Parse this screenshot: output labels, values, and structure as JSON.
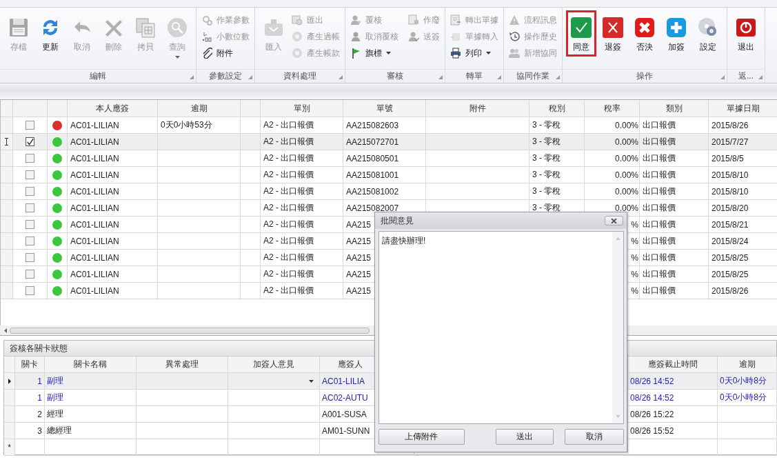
{
  "ribbon": {
    "groups": [
      {
        "label": "編輯",
        "items": [
          {
            "kind": "large",
            "label": "存檔",
            "disabled": true,
            "dropdown": false
          },
          {
            "kind": "large",
            "label": "更新",
            "disabled": false,
            "dropdown": false
          },
          {
            "kind": "large",
            "label": "取消",
            "disabled": true,
            "dropdown": false
          },
          {
            "kind": "large",
            "label": "刪除",
            "disabled": true,
            "dropdown": false
          },
          {
            "kind": "large",
            "label": "拷貝",
            "disabled": true,
            "dropdown": false
          },
          {
            "kind": "large",
            "label": "查詢",
            "disabled": true,
            "dropdown": true
          }
        ]
      },
      {
        "label": "參數設定",
        "items": [
          {
            "kind": "small",
            "label": "作業參數",
            "disabled": true
          },
          {
            "kind": "small",
            "label": "小數位數",
            "disabled": true
          },
          {
            "kind": "small",
            "label": "附件",
            "disabled": false
          }
        ]
      },
      {
        "label": "資料處理",
        "items": [
          {
            "kind": "large",
            "label": "匯入",
            "disabled": true
          },
          {
            "kind": "small",
            "label": "匯出",
            "disabled": true
          },
          {
            "kind": "small",
            "label": "產生過帳",
            "disabled": true
          },
          {
            "kind": "small",
            "label": "產生帳款",
            "disabled": true
          }
        ]
      },
      {
        "label": "審核",
        "items": [
          {
            "kind": "small",
            "label": "覆核",
            "disabled": true,
            "dropdown": false
          },
          {
            "kind": "small",
            "label": "取消覆核",
            "disabled": true,
            "dropdown": false
          },
          {
            "kind": "small",
            "label": "旗標",
            "disabled": false,
            "dropdown": true
          },
          {
            "kind": "small",
            "label": "作廢",
            "disabled": true,
            "dropdown": false
          },
          {
            "kind": "small",
            "label": "送簽",
            "disabled": true,
            "dropdown": false
          }
        ]
      },
      {
        "label": "轉單",
        "items": [
          {
            "kind": "small",
            "label": "轉出單據",
            "disabled": true,
            "dropdown": false
          },
          {
            "kind": "small",
            "label": "單據轉入",
            "disabled": true,
            "dropdown": false
          },
          {
            "kind": "small",
            "label": "列印",
            "disabled": false,
            "dropdown": true
          }
        ]
      },
      {
        "label": "協同作業",
        "items": [
          {
            "kind": "small",
            "label": "流程訊息",
            "disabled": true
          },
          {
            "kind": "small",
            "label": "操作歷史",
            "disabled": true
          },
          {
            "kind": "small",
            "label": "新增協同",
            "disabled": true
          }
        ]
      },
      {
        "label": "操作",
        "items": [
          {
            "kind": "large",
            "label": "同意",
            "disabled": false,
            "highlighted": true
          },
          {
            "kind": "large",
            "label": "退簽",
            "disabled": false,
            "highlighted": false
          },
          {
            "kind": "large",
            "label": "否決",
            "disabled": false,
            "highlighted": false
          },
          {
            "kind": "large",
            "label": "加簽",
            "disabled": false,
            "highlighted": false
          },
          {
            "kind": "large",
            "label": "設定",
            "disabled": false,
            "highlighted": false
          }
        ]
      },
      {
        "label": "返...",
        "items": [
          {
            "kind": "large",
            "label": "退出",
            "disabled": false
          }
        ]
      }
    ]
  },
  "documents": {
    "columns": [
      "本人應簽",
      "逾期",
      "單別",
      "單號",
      "附件",
      "稅別",
      "稅率",
      "類別",
      "單據日期"
    ],
    "rows": [
      {
        "selected": false,
        "checked": false,
        "color": "#d8312e",
        "signer": "AC01-LILIAN",
        "overdue": "0天0小時53分",
        "doc_type": "A2 - 出口報價",
        "doc_no": "AA215082603",
        "tax_type": "3 - 零稅",
        "tax_rate": "0.00%",
        "category": "出口報價",
        "date": "2015/8/26"
      },
      {
        "selected": true,
        "checked": true,
        "color": "#3cc63c",
        "signer": "AC01-LILIAN",
        "doc_type": "A2 - 出口報價",
        "doc_no": "AA215072701",
        "tax_type": "3 - 零稅",
        "tax_rate": "0.00%",
        "category": "出口報價",
        "date": "2015/7/27"
      },
      {
        "selected": false,
        "checked": false,
        "color": "#3cc63c",
        "signer": "AC01-LILIAN",
        "doc_type": "A2 - 出口報價",
        "doc_no": "AA215080501",
        "tax_type": "3 - 零稅",
        "tax_rate": "0.00%",
        "category": "出口報價",
        "date": "2015/8/5"
      },
      {
        "selected": false,
        "checked": false,
        "color": "#3cc63c",
        "signer": "AC01-LILIAN",
        "doc_type": "A2 - 出口報價",
        "doc_no": "AA215081001",
        "tax_type": "3 - 零稅",
        "tax_rate": "0.00%",
        "category": "出口報價",
        "date": "2015/8/10"
      },
      {
        "selected": false,
        "checked": false,
        "color": "#3cc63c",
        "signer": "AC01-LILIAN",
        "doc_type": "A2 - 出口報價",
        "doc_no": "AA215081002",
        "tax_type": "3 - 零稅",
        "tax_rate": "0.00%",
        "category": "出口報價",
        "date": "2015/8/10"
      },
      {
        "selected": false,
        "checked": false,
        "color": "#3cc63c",
        "signer": "AC01-LILIAN",
        "doc_type": "A2 - 出口報價",
        "doc_no": "AA215082007",
        "tax_type": "3 - 零稅",
        "tax_rate": "0.00%",
        "category": "出口報價",
        "date": "2015/8/20"
      },
      {
        "selected": false,
        "checked": false,
        "color": "#3cc63c",
        "signer": "AC01-LILIAN",
        "doc_type": "A2 - 出口報價",
        "doc_no": "AA215",
        "tax_rate": "%",
        "category": "出口報價",
        "date": "2015/8/21"
      },
      {
        "selected": false,
        "checked": false,
        "color": "#3cc63c",
        "signer": "AC01-LILIAN",
        "doc_type": "A2 - 出口報價",
        "doc_no": "AA215",
        "tax_rate": "%",
        "category": "出口報價",
        "date": "2015/8/24"
      },
      {
        "selected": false,
        "checked": false,
        "color": "#3cc63c",
        "signer": "AC01-LILIAN",
        "doc_type": "A2 - 出口報價",
        "doc_no": "AA215",
        "tax_rate": "%",
        "category": "出口報價",
        "date": "2015/8/25"
      },
      {
        "selected": false,
        "checked": false,
        "color": "#3cc63c",
        "signer": "AC01-LILIAN",
        "doc_type": "A2 - 出口報價",
        "doc_no": "AA215",
        "tax_rate": "%",
        "category": "出口報價",
        "date": "2015/8/25"
      },
      {
        "selected": false,
        "checked": false,
        "color": "#3cc63c",
        "signer": "AC01-LILIAN",
        "doc_type": "A2 - 出口報價",
        "doc_no": "AA215",
        "tax_rate": "%",
        "category": "出口報價",
        "date": "2015/8/26"
      }
    ]
  },
  "approval_stages": {
    "title": "簽核各關卡狀態",
    "columns": [
      "關卡",
      "關卡名稱",
      "異常處理",
      "加簽人意見",
      "應簽人",
      "應簽截止時間",
      "逾期"
    ],
    "rows": [
      {
        "selected": true,
        "current": true,
        "stage": "1",
        "stage_name": "副理",
        "signer": "AC01-LILIA",
        "deadline": "08/26 14:52",
        "overdue": "0天0小時8分"
      },
      {
        "selected": false,
        "current": true,
        "stage": "1",
        "stage_name": "副理",
        "signer": "AC02-AUTU",
        "deadline": "08/26 14:52",
        "overdue": "0天0小時8分"
      },
      {
        "selected": false,
        "current": false,
        "stage": "2",
        "stage_name": "經理",
        "signer": "A001-SUSA",
        "deadline": "08/26 15:22"
      },
      {
        "selected": false,
        "current": false,
        "stage": "3",
        "stage_name": "總經理",
        "signer": "AM01-SUNN",
        "deadline": "08/26 15:52"
      }
    ],
    "new_row_marker": "*"
  },
  "dialog": {
    "title": "批閱意見",
    "comment": "請盡快辦理!",
    "buttons": [
      "上傳附件",
      "送出",
      "取消"
    ]
  }
}
